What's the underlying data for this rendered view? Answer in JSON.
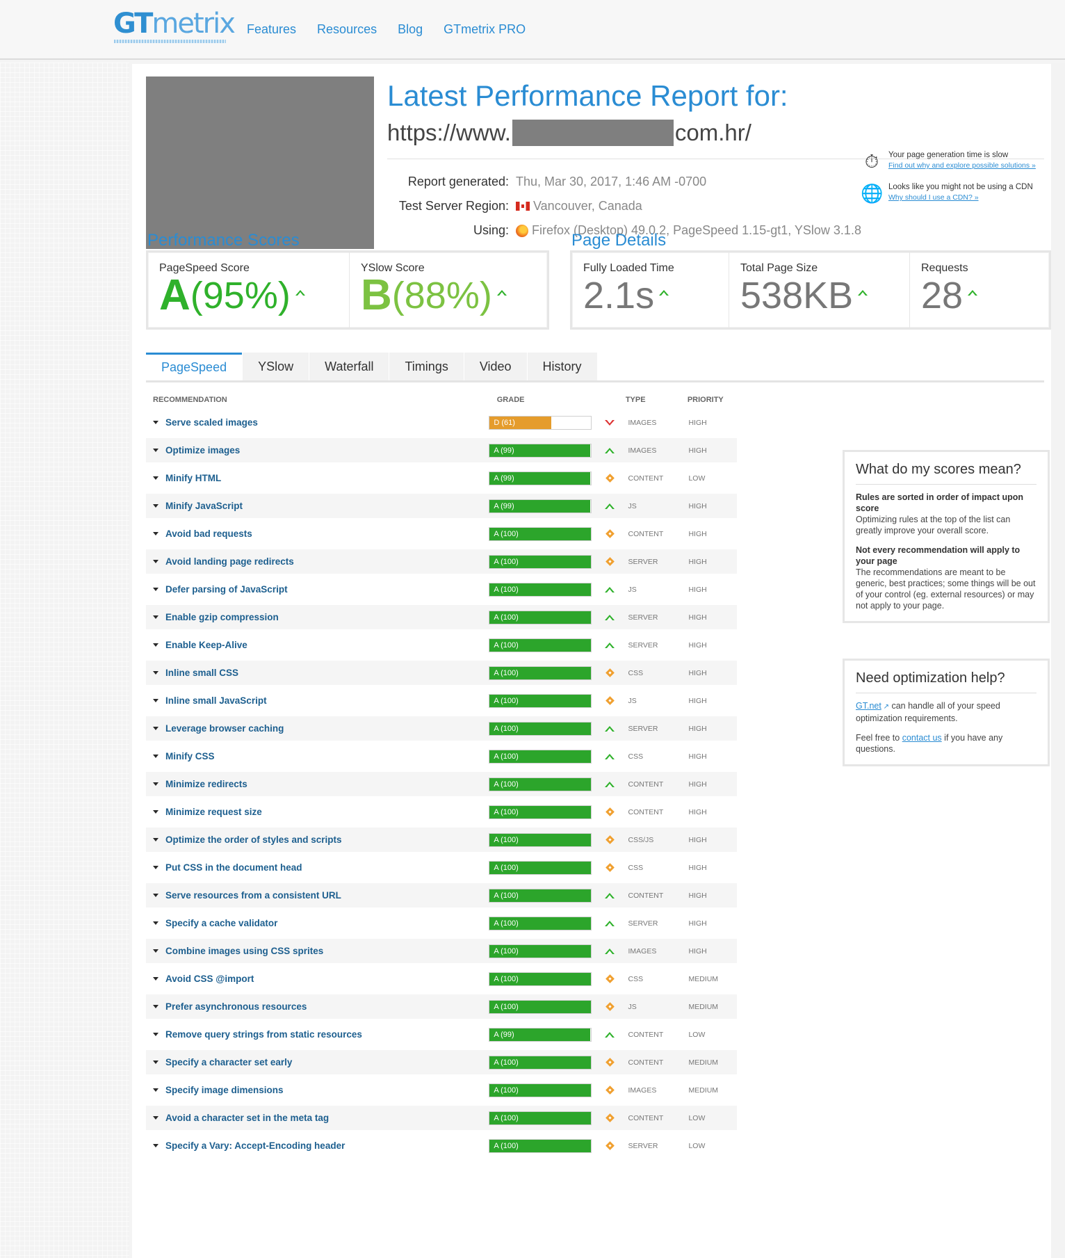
{
  "brand": {
    "logo_a": "GT",
    "logo_b": "metrix"
  },
  "nav": [
    "Features",
    "Resources",
    "Blog",
    "GTmetrix PRO"
  ],
  "report": {
    "title": "Latest Performance Report for:",
    "url_prefix": "https://www.",
    "url_suffix": "com.hr/",
    "generated_label": "Report generated:",
    "generated_value": "Thu, Mar 30, 2017, 1:46 AM -0700",
    "region_label": "Test Server Region:",
    "region_value": "Vancouver, Canada",
    "using_label": "Using:",
    "using_value": "Firefox (Desktop) 49.0.2, PageSpeed 1.15-gt1, YSlow 3.1.8"
  },
  "notices": [
    {
      "text": "Your page generation time is slow",
      "link": "Find out why and explore possible solutions »"
    },
    {
      "text": "Looks like you might not be using a CDN",
      "link": "Why should I use a CDN? »"
    }
  ],
  "performance": {
    "title": "Performance Scores",
    "pagespeed_label": "PageSpeed Score",
    "pagespeed_grade": "A",
    "pagespeed_pct": "(95%)",
    "yslow_label": "YSlow Score",
    "yslow_grade": "B",
    "yslow_pct": "(88%)"
  },
  "details": {
    "title": "Page Details",
    "loaded_label": "Fully Loaded Time",
    "loaded_value": "2.1s",
    "size_label": "Total Page Size",
    "size_value": "538KB",
    "requests_label": "Requests",
    "requests_value": "28"
  },
  "tabs": [
    "PageSpeed",
    "YSlow",
    "Waterfall",
    "Timings",
    "Video",
    "History"
  ],
  "table": {
    "headers": {
      "recommendation": "RECOMMENDATION",
      "grade": "GRADE",
      "type": "TYPE",
      "priority": "PRIORITY"
    },
    "rows": [
      {
        "name": "Serve scaled images",
        "grade": "D (61)",
        "score": 61,
        "trend": "down",
        "type": "IMAGES",
        "priority": "HIGH"
      },
      {
        "name": "Optimize images",
        "grade": "A (99)",
        "score": 99,
        "trend": "up",
        "type": "IMAGES",
        "priority": "HIGH"
      },
      {
        "name": "Minify HTML",
        "grade": "A (99)",
        "score": 99,
        "trend": "same",
        "type": "CONTENT",
        "priority": "LOW"
      },
      {
        "name": "Minify JavaScript",
        "grade": "A (99)",
        "score": 99,
        "trend": "up",
        "type": "JS",
        "priority": "HIGH"
      },
      {
        "name": "Avoid bad requests",
        "grade": "A (100)",
        "score": 100,
        "trend": "same",
        "type": "CONTENT",
        "priority": "HIGH"
      },
      {
        "name": "Avoid landing page redirects",
        "grade": "A (100)",
        "score": 100,
        "trend": "same",
        "type": "SERVER",
        "priority": "HIGH"
      },
      {
        "name": "Defer parsing of JavaScript",
        "grade": "A (100)",
        "score": 100,
        "trend": "up",
        "type": "JS",
        "priority": "HIGH"
      },
      {
        "name": "Enable gzip compression",
        "grade": "A (100)",
        "score": 100,
        "trend": "up",
        "type": "SERVER",
        "priority": "HIGH"
      },
      {
        "name": "Enable Keep-Alive",
        "grade": "A (100)",
        "score": 100,
        "trend": "up",
        "type": "SERVER",
        "priority": "HIGH"
      },
      {
        "name": "Inline small CSS",
        "grade": "A (100)",
        "score": 100,
        "trend": "same",
        "type": "CSS",
        "priority": "HIGH"
      },
      {
        "name": "Inline small JavaScript",
        "grade": "A (100)",
        "score": 100,
        "trend": "same",
        "type": "JS",
        "priority": "HIGH"
      },
      {
        "name": "Leverage browser caching",
        "grade": "A (100)",
        "score": 100,
        "trend": "up",
        "type": "SERVER",
        "priority": "HIGH"
      },
      {
        "name": "Minify CSS",
        "grade": "A (100)",
        "score": 100,
        "trend": "up",
        "type": "CSS",
        "priority": "HIGH"
      },
      {
        "name": "Minimize redirects",
        "grade": "A (100)",
        "score": 100,
        "trend": "up",
        "type": "CONTENT",
        "priority": "HIGH"
      },
      {
        "name": "Minimize request size",
        "grade": "A (100)",
        "score": 100,
        "trend": "same",
        "type": "CONTENT",
        "priority": "HIGH"
      },
      {
        "name": "Optimize the order of styles and scripts",
        "grade": "A (100)",
        "score": 100,
        "trend": "same",
        "type": "CSS/JS",
        "priority": "HIGH"
      },
      {
        "name": "Put CSS in the document head",
        "grade": "A (100)",
        "score": 100,
        "trend": "same",
        "type": "CSS",
        "priority": "HIGH"
      },
      {
        "name": "Serve resources from a consistent URL",
        "grade": "A (100)",
        "score": 100,
        "trend": "up",
        "type": "CONTENT",
        "priority": "HIGH"
      },
      {
        "name": "Specify a cache validator",
        "grade": "A (100)",
        "score": 100,
        "trend": "up",
        "type": "SERVER",
        "priority": "HIGH"
      },
      {
        "name": "Combine images using CSS sprites",
        "grade": "A (100)",
        "score": 100,
        "trend": "up",
        "type": "IMAGES",
        "priority": "HIGH"
      },
      {
        "name": "Avoid CSS @import",
        "grade": "A (100)",
        "score": 100,
        "trend": "same",
        "type": "CSS",
        "priority": "MEDIUM"
      },
      {
        "name": "Prefer asynchronous resources",
        "grade": "A (100)",
        "score": 100,
        "trend": "same",
        "type": "JS",
        "priority": "MEDIUM"
      },
      {
        "name": "Remove query strings from static resources",
        "grade": "A (99)",
        "score": 99,
        "trend": "up",
        "type": "CONTENT",
        "priority": "LOW"
      },
      {
        "name": "Specify a character set early",
        "grade": "A (100)",
        "score": 100,
        "trend": "same",
        "type": "CONTENT",
        "priority": "MEDIUM"
      },
      {
        "name": "Specify image dimensions",
        "grade": "A (100)",
        "score": 100,
        "trend": "same",
        "type": "IMAGES",
        "priority": "MEDIUM"
      },
      {
        "name": "Avoid a character set in the meta tag",
        "grade": "A (100)",
        "score": 100,
        "trend": "same",
        "type": "CONTENT",
        "priority": "LOW"
      },
      {
        "name": "Specify a Vary: Accept-Encoding header",
        "grade": "A (100)",
        "score": 100,
        "trend": "same",
        "type": "SERVER",
        "priority": "LOW"
      }
    ]
  },
  "sidebar": {
    "scores_title": "What do my scores mean?",
    "scores_h1": "Rules are sorted in order of impact upon score",
    "scores_p1": "Optimizing rules at the top of the list can greatly improve your overall score.",
    "scores_h2": "Not every recommendation will apply to your page",
    "scores_p2": "The recommendations are meant to be generic, best practices; some things will be out of your control (eg. external resources) or may not apply to your page.",
    "help_title": "Need optimization help?",
    "help_link": "GT.net",
    "help_p1": " can handle all of your speed optimization requirements.",
    "help_p2a": "Feel free to ",
    "help_p2_link": "contact us",
    "help_p2b": " if you have any questions."
  },
  "colors": {
    "accent": "#2a8cd3",
    "grade_a": "#2ca52b",
    "grade_d": "#e59c2c",
    "trend_down": "#dd3333",
    "trend_same": "#f0a030"
  }
}
